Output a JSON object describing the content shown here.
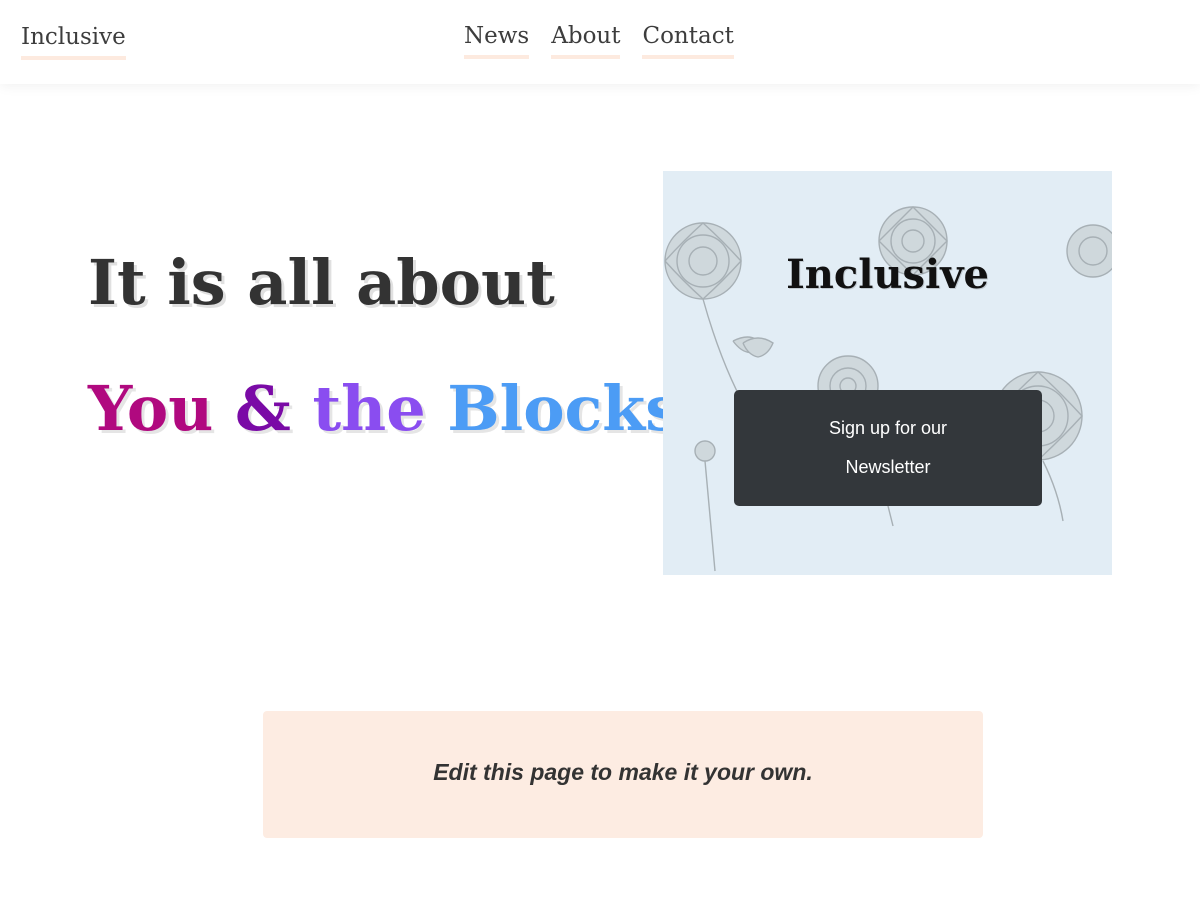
{
  "header": {
    "site_title": "Inclusive",
    "nav": [
      "News",
      "About",
      "Contact"
    ]
  },
  "hero": {
    "line1": "It is all about",
    "line2_words": [
      {
        "text": "You",
        "color": "#b0097f"
      },
      {
        "text": "&",
        "color": "#7a0aa6"
      },
      {
        "text": "the",
        "color": "#8a4df0"
      },
      {
        "text": "Blocks",
        "color": "#4c9cf5"
      }
    ]
  },
  "card": {
    "title": "Inclusive",
    "button_label": "Sign up for our Newsletter",
    "background_color": "#e2edf5",
    "button_color": "#33373b"
  },
  "notice": {
    "text": "Edit this page to make it your own.",
    "background_color": "#fdece2"
  },
  "colors": {
    "underline_accent": "#fdeadf",
    "text_primary": "#333333"
  }
}
